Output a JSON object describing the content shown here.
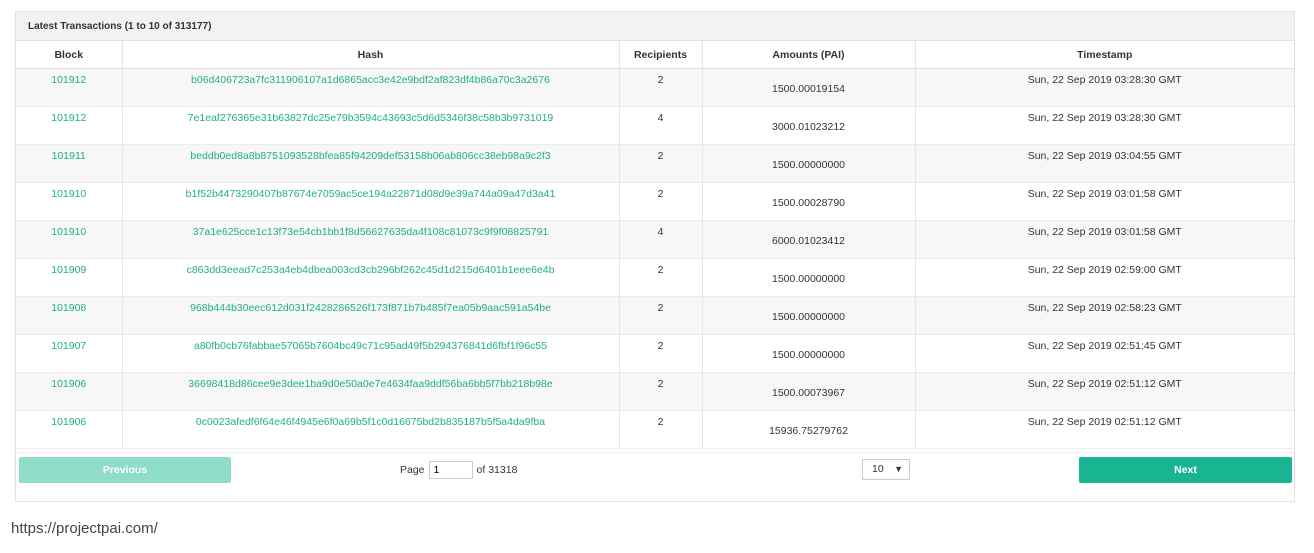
{
  "panel": {
    "title": "Latest Transactions (1 to 10 of 313177)"
  },
  "table": {
    "headers": [
      "Block",
      "Hash",
      "Recipients",
      "Amounts (PAI)",
      "Timestamp"
    ],
    "rows": [
      {
        "block": "101912",
        "hash": "b06d406723a7fc311906107a1d6865acc3e42e9bdf2af823df4b86a70c3a2676",
        "recipients": "2",
        "amount": "1500.00019154",
        "timestamp": "Sun, 22 Sep 2019 03:28:30 GMT"
      },
      {
        "block": "101912",
        "hash": "7e1eaf276365e31b63827dc25e79b3594c43693c5d6d5346f38c58b3b9731019",
        "recipients": "4",
        "amount": "3000.01023212",
        "timestamp": "Sun, 22 Sep 2019 03:28:30 GMT"
      },
      {
        "block": "101911",
        "hash": "beddb0ed8a8b8751093528bfea85f94209def53158b06ab806cc38eb98a9c2f3",
        "recipients": "2",
        "amount": "1500.00000000",
        "timestamp": "Sun, 22 Sep 2019 03:04:55 GMT"
      },
      {
        "block": "101910",
        "hash": "b1f52b4473290407b87674e7059ac5ce194a22871d08d9e39a744a09a47d3a41",
        "recipients": "2",
        "amount": "1500.00028790",
        "timestamp": "Sun, 22 Sep 2019 03:01:58 GMT"
      },
      {
        "block": "101910",
        "hash": "37a1e625cce1c13f73e54cb1bb1f8d56627635da4f108c81073c9f9f08825791",
        "recipients": "4",
        "amount": "6000.01023412",
        "timestamp": "Sun, 22 Sep 2019 03:01:58 GMT"
      },
      {
        "block": "101909",
        "hash": "c863dd3eead7c253a4eb4dbea003cd3cb296bf262c45d1d215d6401b1eee6e4b",
        "recipients": "2",
        "amount": "1500.00000000",
        "timestamp": "Sun, 22 Sep 2019 02:59:00 GMT"
      },
      {
        "block": "101908",
        "hash": "968b444b30eec612d031f2428286526f173f871b7b485f7ea05b9aac591a54be",
        "recipients": "2",
        "amount": "1500.00000000",
        "timestamp": "Sun, 22 Sep 2019 02:58:23 GMT"
      },
      {
        "block": "101907",
        "hash": "a80fb0cb76fabbae57065b7604bc49c71c95ad49f5b294376841d6fbf1f96c55",
        "recipients": "2",
        "amount": "1500.00000000",
        "timestamp": "Sun, 22 Sep 2019 02:51:45 GMT"
      },
      {
        "block": "101906",
        "hash": "36698418d86cee9e3dee1ba9d0e50a0e7e4634faa9ddf56ba6bb5f7bb218b98e",
        "recipients": "2",
        "amount": "1500.00073967",
        "timestamp": "Sun, 22 Sep 2019 02:51:12 GMT"
      },
      {
        "block": "101906",
        "hash": "0c0023afedf6f64e46f4945e6f0a69b5f1c0d16675bd2b835187b5f5a4da9fba",
        "recipients": "2",
        "amount": "15936.75279762",
        "timestamp": "Sun, 22 Sep 2019 02:51:12 GMT"
      }
    ]
  },
  "pagination": {
    "previous_label": "Previous",
    "next_label": "Next",
    "page_label": "Page",
    "page_value": "1",
    "of_label": "of 31318",
    "page_size": "10",
    "caret": "▼"
  },
  "footer": {
    "url": "https://projectpai.com/"
  },
  "colors": {
    "link": "#1fae8c",
    "next_button": "#19b593",
    "prev_button": "#8fdcc9"
  }
}
